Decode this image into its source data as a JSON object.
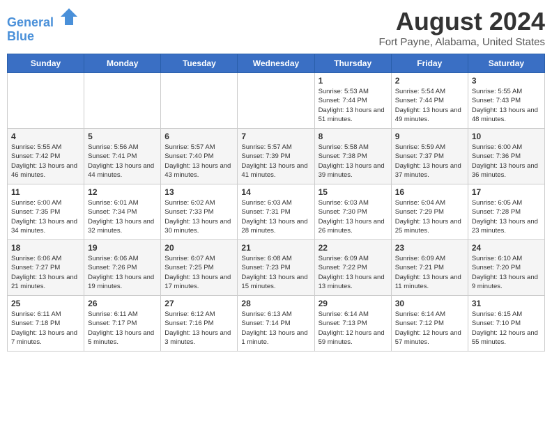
{
  "header": {
    "logo_line1": "General",
    "logo_line2": "Blue",
    "month_year": "August 2024",
    "location": "Fort Payne, Alabama, United States"
  },
  "days_of_week": [
    "Sunday",
    "Monday",
    "Tuesday",
    "Wednesday",
    "Thursday",
    "Friday",
    "Saturday"
  ],
  "weeks": [
    [
      {
        "day": "",
        "info": ""
      },
      {
        "day": "",
        "info": ""
      },
      {
        "day": "",
        "info": ""
      },
      {
        "day": "",
        "info": ""
      },
      {
        "day": "1",
        "info": "Sunrise: 5:53 AM\nSunset: 7:44 PM\nDaylight: 13 hours\nand 51 minutes."
      },
      {
        "day": "2",
        "info": "Sunrise: 5:54 AM\nSunset: 7:44 PM\nDaylight: 13 hours\nand 49 minutes."
      },
      {
        "day": "3",
        "info": "Sunrise: 5:55 AM\nSunset: 7:43 PM\nDaylight: 13 hours\nand 48 minutes."
      }
    ],
    [
      {
        "day": "4",
        "info": "Sunrise: 5:55 AM\nSunset: 7:42 PM\nDaylight: 13 hours\nand 46 minutes."
      },
      {
        "day": "5",
        "info": "Sunrise: 5:56 AM\nSunset: 7:41 PM\nDaylight: 13 hours\nand 44 minutes."
      },
      {
        "day": "6",
        "info": "Sunrise: 5:57 AM\nSunset: 7:40 PM\nDaylight: 13 hours\nand 43 minutes."
      },
      {
        "day": "7",
        "info": "Sunrise: 5:57 AM\nSunset: 7:39 PM\nDaylight: 13 hours\nand 41 minutes."
      },
      {
        "day": "8",
        "info": "Sunrise: 5:58 AM\nSunset: 7:38 PM\nDaylight: 13 hours\nand 39 minutes."
      },
      {
        "day": "9",
        "info": "Sunrise: 5:59 AM\nSunset: 7:37 PM\nDaylight: 13 hours\nand 37 minutes."
      },
      {
        "day": "10",
        "info": "Sunrise: 6:00 AM\nSunset: 7:36 PM\nDaylight: 13 hours\nand 36 minutes."
      }
    ],
    [
      {
        "day": "11",
        "info": "Sunrise: 6:00 AM\nSunset: 7:35 PM\nDaylight: 13 hours\nand 34 minutes."
      },
      {
        "day": "12",
        "info": "Sunrise: 6:01 AM\nSunset: 7:34 PM\nDaylight: 13 hours\nand 32 minutes."
      },
      {
        "day": "13",
        "info": "Sunrise: 6:02 AM\nSunset: 7:33 PM\nDaylight: 13 hours\nand 30 minutes."
      },
      {
        "day": "14",
        "info": "Sunrise: 6:03 AM\nSunset: 7:31 PM\nDaylight: 13 hours\nand 28 minutes."
      },
      {
        "day": "15",
        "info": "Sunrise: 6:03 AM\nSunset: 7:30 PM\nDaylight: 13 hours\nand 26 minutes."
      },
      {
        "day": "16",
        "info": "Sunrise: 6:04 AM\nSunset: 7:29 PM\nDaylight: 13 hours\nand 25 minutes."
      },
      {
        "day": "17",
        "info": "Sunrise: 6:05 AM\nSunset: 7:28 PM\nDaylight: 13 hours\nand 23 minutes."
      }
    ],
    [
      {
        "day": "18",
        "info": "Sunrise: 6:06 AM\nSunset: 7:27 PM\nDaylight: 13 hours\nand 21 minutes."
      },
      {
        "day": "19",
        "info": "Sunrise: 6:06 AM\nSunset: 7:26 PM\nDaylight: 13 hours\nand 19 minutes."
      },
      {
        "day": "20",
        "info": "Sunrise: 6:07 AM\nSunset: 7:25 PM\nDaylight: 13 hours\nand 17 minutes."
      },
      {
        "day": "21",
        "info": "Sunrise: 6:08 AM\nSunset: 7:23 PM\nDaylight: 13 hours\nand 15 minutes."
      },
      {
        "day": "22",
        "info": "Sunrise: 6:09 AM\nSunset: 7:22 PM\nDaylight: 13 hours\nand 13 minutes."
      },
      {
        "day": "23",
        "info": "Sunrise: 6:09 AM\nSunset: 7:21 PM\nDaylight: 13 hours\nand 11 minutes."
      },
      {
        "day": "24",
        "info": "Sunrise: 6:10 AM\nSunset: 7:20 PM\nDaylight: 13 hours\nand 9 minutes."
      }
    ],
    [
      {
        "day": "25",
        "info": "Sunrise: 6:11 AM\nSunset: 7:18 PM\nDaylight: 13 hours\nand 7 minutes."
      },
      {
        "day": "26",
        "info": "Sunrise: 6:11 AM\nSunset: 7:17 PM\nDaylight: 13 hours\nand 5 minutes."
      },
      {
        "day": "27",
        "info": "Sunrise: 6:12 AM\nSunset: 7:16 PM\nDaylight: 13 hours\nand 3 minutes."
      },
      {
        "day": "28",
        "info": "Sunrise: 6:13 AM\nSunset: 7:14 PM\nDaylight: 13 hours\nand 1 minute."
      },
      {
        "day": "29",
        "info": "Sunrise: 6:14 AM\nSunset: 7:13 PM\nDaylight: 12 hours\nand 59 minutes."
      },
      {
        "day": "30",
        "info": "Sunrise: 6:14 AM\nSunset: 7:12 PM\nDaylight: 12 hours\nand 57 minutes."
      },
      {
        "day": "31",
        "info": "Sunrise: 6:15 AM\nSunset: 7:10 PM\nDaylight: 12 hours\nand 55 minutes."
      }
    ]
  ]
}
